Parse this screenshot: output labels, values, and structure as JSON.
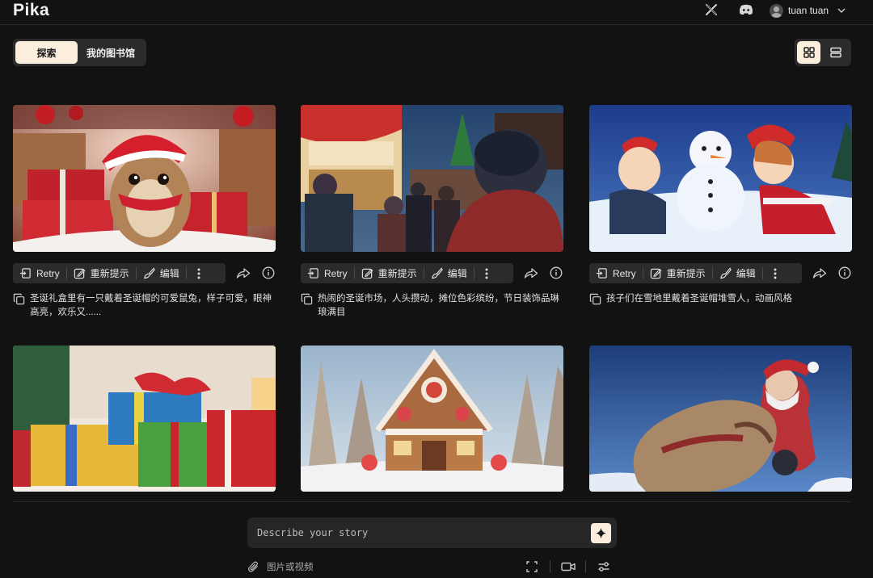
{
  "header": {
    "logo": "Pika",
    "username": "tuan tuan"
  },
  "tabs": [
    {
      "label": "探索",
      "active": true
    },
    {
      "label": "我的图书馆",
      "active": false
    }
  ],
  "view_toggle": {
    "active": "grid",
    "options": [
      "grid-view-icon",
      "list-view-icon"
    ]
  },
  "card_actions": {
    "retry": "Retry",
    "rephrase": "重新提示",
    "edit": "编辑"
  },
  "cards": [
    {
      "caption": "圣诞礼盒里有一只戴着圣诞帽的可爱鼠兔，样子可爱，眼神高亮，欢乐又......",
      "scene": "pika-hamster-gifts"
    },
    {
      "caption": "热闹的圣诞市场，人头攒动，摊位色彩缤纷，节日装饰品琳琅满目",
      "scene": "christmas-market"
    },
    {
      "caption": "孩子们在雪地里戴着圣诞帽堆雪人，动画风格",
      "scene": "kids-snowman"
    },
    {
      "caption": "",
      "scene": "gift-boxes"
    },
    {
      "caption": "",
      "scene": "gingerbread-house"
    },
    {
      "caption": "",
      "scene": "santa-sack"
    }
  ],
  "composer": {
    "placeholder": "Describe your story",
    "attach_label": "图片或视频"
  },
  "colors": {
    "background": "#121212",
    "accent": "#fbeedd",
    "panel": "#2b2b2b"
  }
}
